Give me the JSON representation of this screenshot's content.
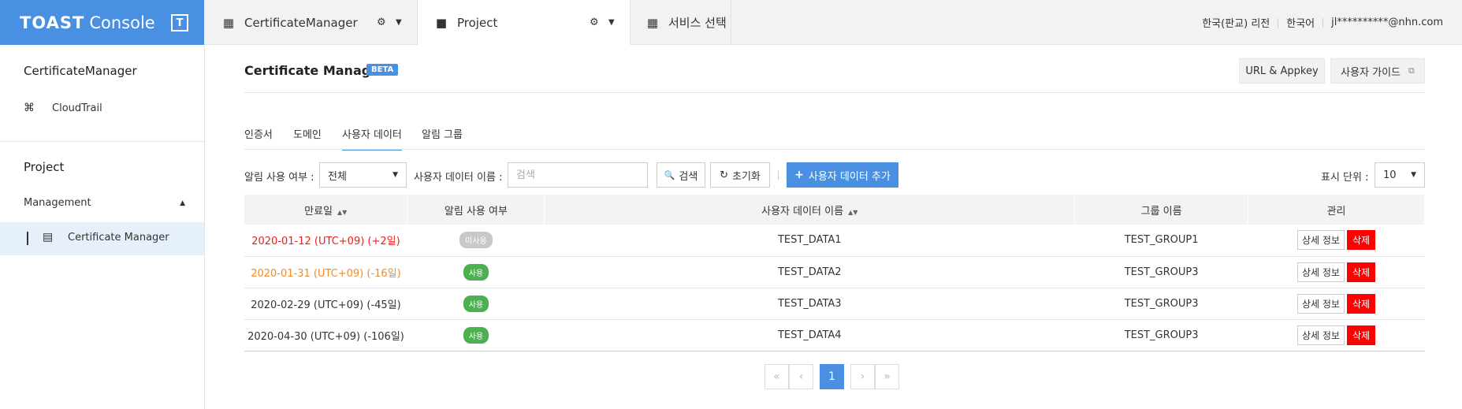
{
  "topbar": {
    "brand": "TOAST",
    "console": "Console",
    "tbox": "T",
    "tabs": [
      {
        "label": "CertificateManager"
      },
      {
        "label": "Project"
      },
      {
        "label": "서비스 선택"
      }
    ],
    "region": "한국(판교) 리전",
    "language": "한국어",
    "user": "jl**********@nhn.com"
  },
  "sidebar": {
    "section1": "CertificateManager",
    "cloudtrail": "CloudTrail",
    "section2": "Project",
    "management": "Management",
    "certificate_manager": "Certificate Manager"
  },
  "header": {
    "title": "Certificate Manager",
    "beta": "BETA",
    "url_appkey": "URL & Appkey",
    "user_guide": "사용자 가이드"
  },
  "tabs": [
    "인증서",
    "도메인",
    "사용자 데이터",
    "알림 그룹"
  ],
  "filter": {
    "alarm_label": "알림 사용 여부 :",
    "alarm_value": "전체",
    "name_label": "사용자 데이터 이름 :",
    "name_placeholder": "검색",
    "search": "검색",
    "reset": "초기화",
    "add": "사용자 데이터 추가",
    "unit_label": "표시 단위 :",
    "unit_value": "10"
  },
  "table": {
    "headers": [
      "만료일",
      "알림 사용 여부",
      "사용자 데이터 이름",
      "그룹 이름",
      "관리"
    ],
    "detail_label": "상세 정보",
    "delete_label": "삭제",
    "rows": [
      {
        "expire": "2020-01-12 (UTC+09) (+2일)",
        "color": "#e8201d",
        "alarm": "미사용",
        "alarm_color": "#c8c8c8",
        "name": "TEST_DATA1",
        "group": "TEST_GROUP1"
      },
      {
        "expire": "2020-01-31 (UTC+09) (-16일)",
        "color": "#f28b25",
        "alarm": "사용",
        "alarm_color": "#4caf50",
        "name": "TEST_DATA2",
        "group": "TEST_GROUP3"
      },
      {
        "expire": "2020-02-29 (UTC+09) (-45일)",
        "color": "#333333",
        "alarm": "사용",
        "alarm_color": "#4caf50",
        "name": "TEST_DATA3",
        "group": "TEST_GROUP3"
      },
      {
        "expire": "2020-04-30 (UTC+09) (-106일)",
        "color": "#333333",
        "alarm": "사용",
        "alarm_color": "#4caf50",
        "name": "TEST_DATA4",
        "group": "TEST_GROUP3"
      }
    ]
  },
  "pagination": {
    "current": "1"
  }
}
